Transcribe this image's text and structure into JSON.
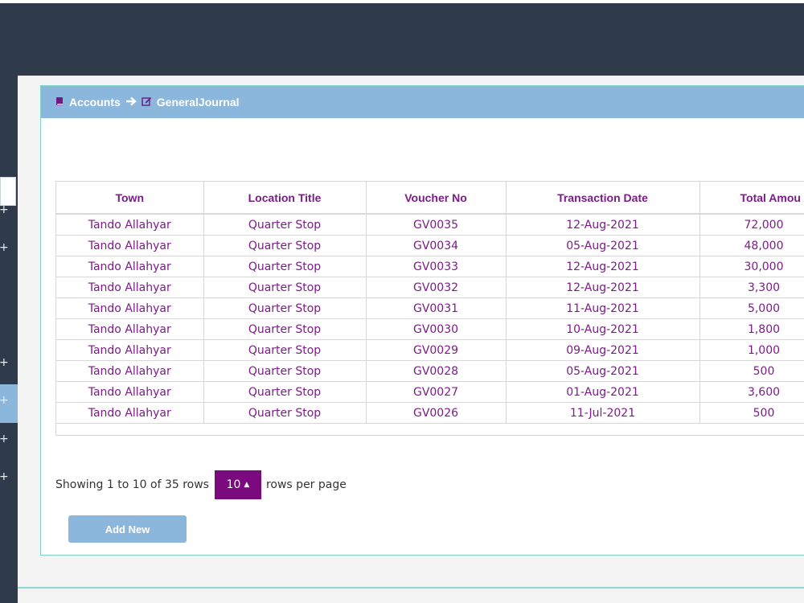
{
  "breadcrumb": {
    "root": "Accounts",
    "current": "GeneralJournal"
  },
  "icons": {
    "book": "book-icon",
    "arrow": "arrow-right-icon",
    "edit": "edit-icon",
    "plus": "plus-icon",
    "caret": "caret-up-icon"
  },
  "colors": {
    "accent": "#7a0a7e",
    "header_bar": "#8cb7dc",
    "topbar": "#2f3b4a"
  },
  "table": {
    "columns": [
      "Town",
      "Location Title",
      "Voucher No",
      "Transaction Date",
      "Total Amou"
    ],
    "rows": [
      [
        "Tando Allahyar",
        "Quarter Stop",
        "GV0035",
        "12-Aug-2021",
        "72,000"
      ],
      [
        "Tando Allahyar",
        "Quarter Stop",
        "GV0034",
        "05-Aug-2021",
        "48,000"
      ],
      [
        "Tando Allahyar",
        "Quarter Stop",
        "GV0033",
        "12-Aug-2021",
        "30,000"
      ],
      [
        "Tando Allahyar",
        "Quarter Stop",
        "GV0032",
        "12-Aug-2021",
        "3,300"
      ],
      [
        "Tando Allahyar",
        "Quarter Stop",
        "GV0031",
        "11-Aug-2021",
        "5,000"
      ],
      [
        "Tando Allahyar",
        "Quarter Stop",
        "GV0030",
        "10-Aug-2021",
        "1,800"
      ],
      [
        "Tando Allahyar",
        "Quarter Stop",
        "GV0029",
        "09-Aug-2021",
        "1,000"
      ],
      [
        "Tando Allahyar",
        "Quarter Stop",
        "GV0028",
        "05-Aug-2021",
        "500"
      ],
      [
        "Tando Allahyar",
        "Quarter Stop",
        "GV0027",
        "01-Aug-2021",
        "3,600"
      ],
      [
        "Tando Allahyar",
        "Quarter Stop",
        "GV0026",
        "11-Jul-2021",
        "500"
      ]
    ]
  },
  "pagination": {
    "showing": "Showing 1 to 10 of 35 rows",
    "page_size": "10",
    "suffix": "rows per page"
  },
  "add_button": "Add New",
  "sidebar": {
    "plus_label": "+"
  }
}
